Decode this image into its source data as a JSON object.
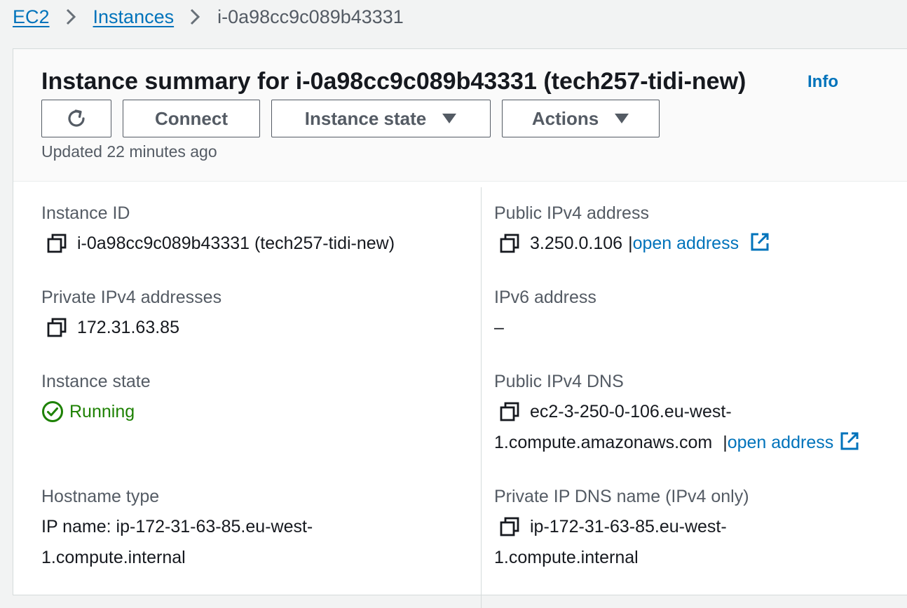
{
  "breadcrumb": {
    "items": [
      {
        "label": "EC2"
      },
      {
        "label": "Instances"
      }
    ],
    "current": "i-0a98cc9c089b43331"
  },
  "header": {
    "title": "Instance summary for i-0a98cc9c089b43331 (tech257-tidi-new)",
    "info_link": "Info",
    "buttons": {
      "connect": "Connect",
      "instance_state": "Instance state",
      "actions": "Actions"
    },
    "updated": "Updated 22 minutes ago"
  },
  "details": {
    "instance_id": {
      "label": "Instance ID",
      "value": "i-0a98cc9c089b43331 (tech257-tidi-new)"
    },
    "public_ipv4": {
      "label": "Public IPv4 address",
      "value": "3.250.0.106",
      "separator": "|",
      "link": "open address"
    },
    "private_ipv4": {
      "label": "Private IPv4 addresses",
      "value": "172.31.63.85"
    },
    "ipv6": {
      "label": "IPv6 address",
      "value": "–"
    },
    "instance_state": {
      "label": "Instance state",
      "value": "Running"
    },
    "public_dns": {
      "label": "Public IPv4 DNS",
      "value_line1": "ec2-3-250-0-106.eu-west-",
      "value_line2": "1.compute.amazonaws.com",
      "separator": "|",
      "link": "open address"
    },
    "hostname_type": {
      "label": "Hostname type",
      "value_line1": "IP name: ip-172-31-63-85.eu-west-",
      "value_line2": "1.compute.internal"
    },
    "private_dns": {
      "label": "Private IP DNS name (IPv4 only)",
      "value_line1": "ip-172-31-63-85.eu-west-",
      "value_line2": "1.compute.internal"
    }
  },
  "colors": {
    "link": "#0073bb",
    "running": "#1d8102",
    "text": "#16191f",
    "muted": "#545b64",
    "page_bg": "#f2f3f3"
  },
  "icons": {
    "refresh": "refresh-icon",
    "copy": "copy-icon",
    "external": "external-link-icon",
    "status_ok": "status-check-icon",
    "caret": "caret-down-icon",
    "chevron": "chevron-right-icon"
  }
}
